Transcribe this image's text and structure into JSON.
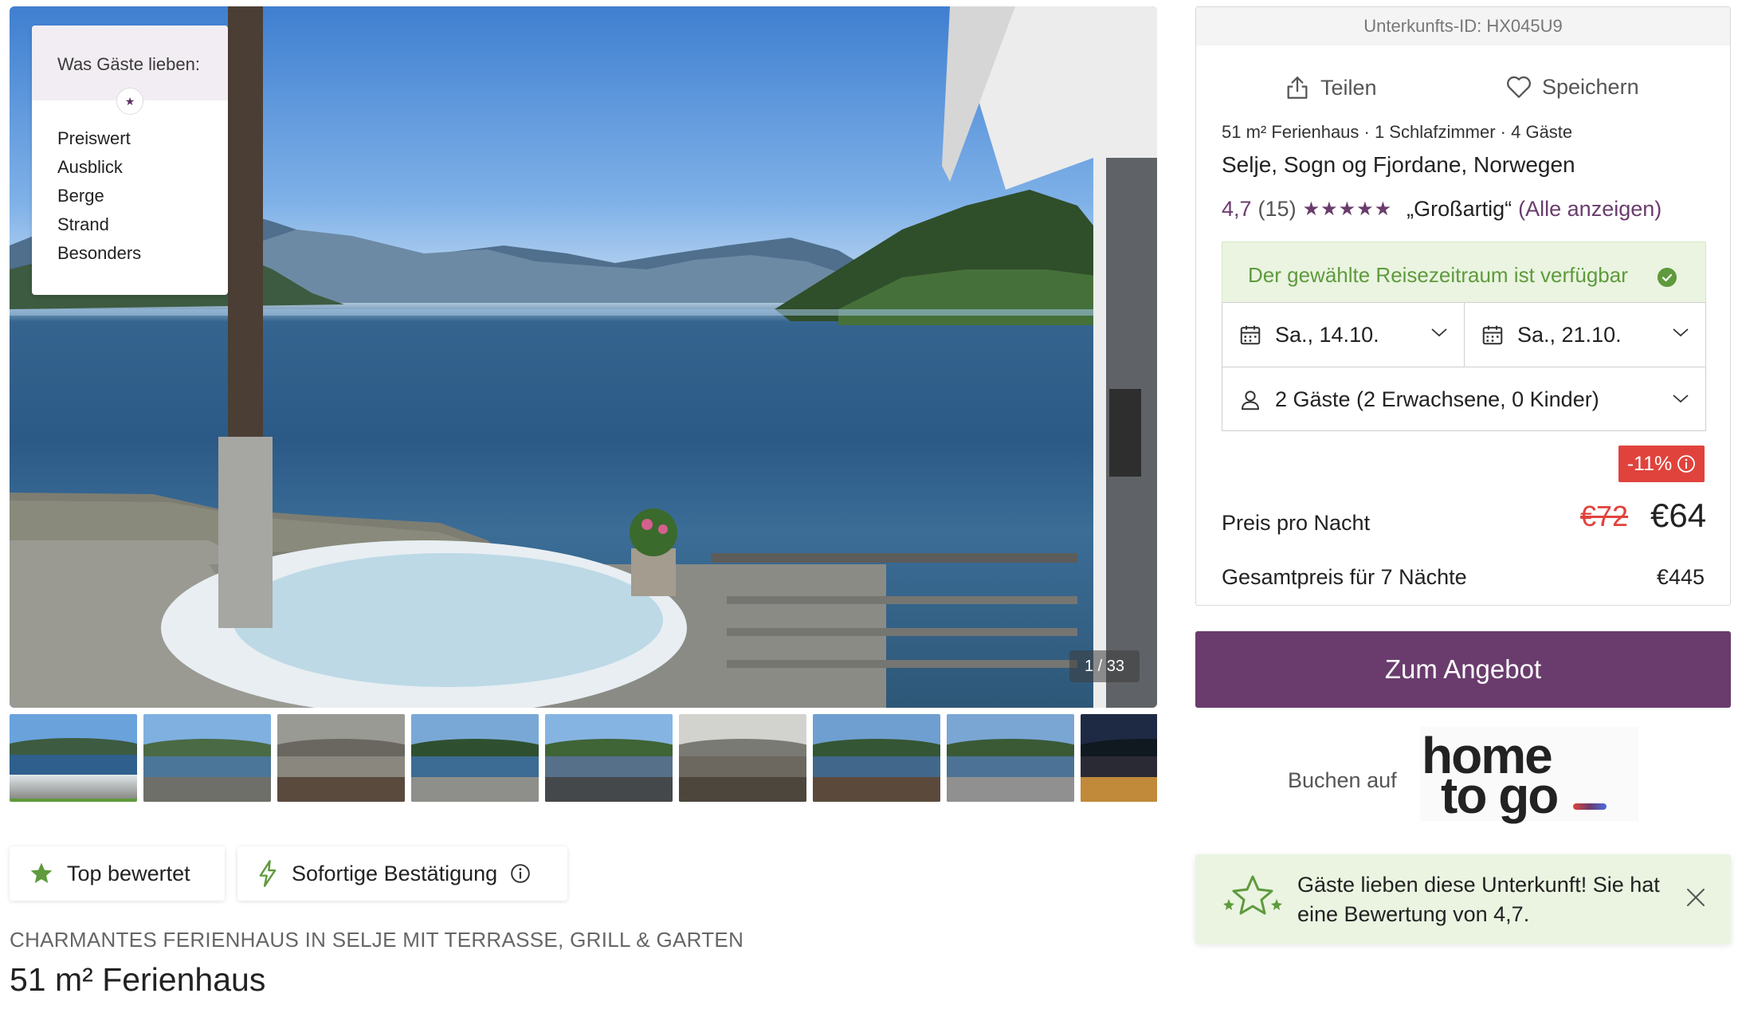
{
  "gallery": {
    "guests_love_title": "Was Gäste lieben:",
    "guests_love_items": [
      "Preiswert",
      "Ausblick",
      "Berge",
      "Strand",
      "Besonders"
    ],
    "photo_counter": "1 / 33"
  },
  "badges": {
    "top_rated": "Top bewertet",
    "instant_confirmation": "Sofortige Bestätigung"
  },
  "listing": {
    "subtitle": "CHARMANTES FERIENHAUS IN SELJE MIT TERRASSE, GRILL & GARTEN",
    "title": "51 m² Ferienhaus"
  },
  "panel": {
    "property_id": "Unterkunfts-ID: HX045U9",
    "share_label": "Teilen",
    "save_label": "Speichern",
    "facts": "51 m² Ferienhaus · 1 Schlafzimmer · 4 Gäste",
    "location": "Selje, Sogn og Fjordane, Norwegen",
    "rating_score": "4,7",
    "rating_count": "(15)",
    "rating_stars": "★★★★★",
    "rating_word": "„Großartig“",
    "rating_all": "(Alle anzeigen)",
    "availability": "Der gewählte Reisezeitraum ist verfügbar",
    "checkin": "Sa., 14.10.",
    "checkout": "Sa., 21.10.",
    "guests": "2 Gäste (2 Erwachsene, 0 Kinder)",
    "discount": "-11%",
    "price_per_night_label": "Preis pro Nacht",
    "old_price": "€72",
    "new_price": "€64",
    "total_label": "Gesamtpreis für 7 Nächte",
    "total_price": "€445"
  },
  "cta": {
    "label": "Zum Angebot"
  },
  "booking": {
    "book_on": "Buchen auf",
    "logo_line1": "home",
    "logo_line2": "to go"
  },
  "toast": {
    "text": "Gäste lieben diese Unterkunft! Sie hat eine Bewertung von 4,7."
  },
  "colors": {
    "brand_purple": "#6a3c6d",
    "success_green": "#5f9a3c",
    "discount_red": "#e0433c"
  }
}
